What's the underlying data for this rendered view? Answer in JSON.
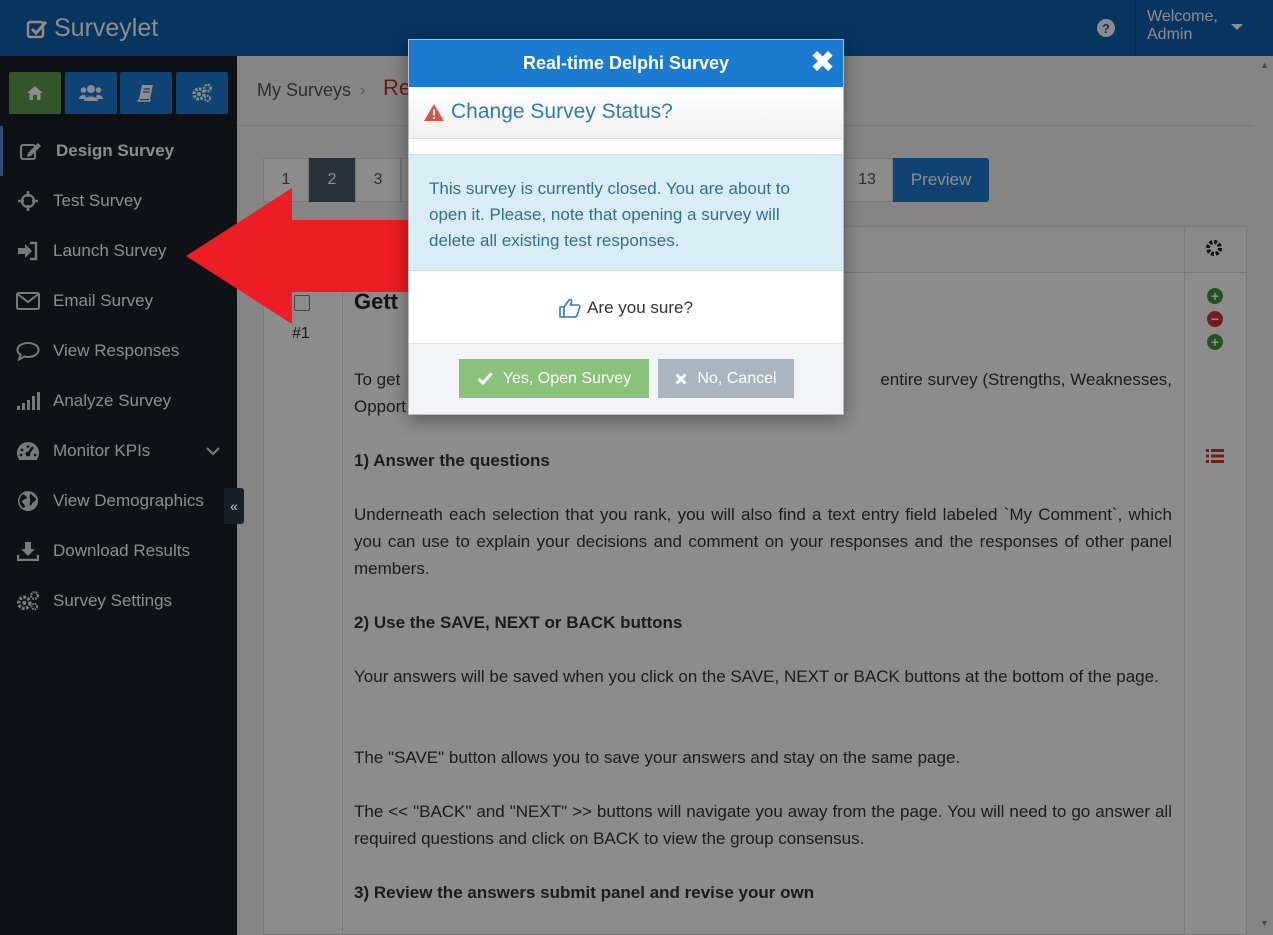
{
  "app": {
    "brand": "Surveylet"
  },
  "header": {
    "welcome_line1": "Welcome,",
    "welcome_line2": "Admin"
  },
  "quick_buttons": [
    {
      "icon": "home-icon",
      "color": "#5b9b4f"
    },
    {
      "icon": "users-icon",
      "color": "#1a7bd1"
    },
    {
      "icon": "book-icon",
      "color": "#1a7bd1"
    },
    {
      "icon": "cogs-icon",
      "color": "#1a7bd1"
    }
  ],
  "sidebar": {
    "items": [
      {
        "label": "Design Survey",
        "icon": "edit-icon",
        "active": true
      },
      {
        "label": "Test Survey",
        "icon": "crosshair-icon"
      },
      {
        "label": "Launch Survey",
        "icon": "sign-in-icon"
      },
      {
        "label": "Email Survey",
        "icon": "envelope-icon"
      },
      {
        "label": "View Responses",
        "icon": "comment-icon"
      },
      {
        "label": "Analyze Survey",
        "icon": "signal-icon"
      },
      {
        "label": "Monitor KPIs",
        "icon": "dashboard-icon"
      },
      {
        "label": "View Demographics",
        "icon": "globe-icon"
      },
      {
        "label": "Download Results",
        "icon": "download-icon"
      },
      {
        "label": "Survey Settings",
        "icon": "cogs-icon"
      }
    ],
    "collapse_label": "«"
  },
  "breadcrumb": {
    "root": "My Surveys",
    "separator": "›",
    "current": "Re"
  },
  "pager": {
    "pages": [
      "1",
      "2",
      "3",
      "13"
    ],
    "active_page": "2",
    "preview_label": "Preview"
  },
  "question": {
    "number": "#1",
    "title_visible": "Gett",
    "intro": "To get",
    "intro_right": "entire survey (Strengths, Weaknesses,",
    "intro_line2": "Opport",
    "paragraphs": [
      {
        "bold": true,
        "text": "1) Answer the questions"
      },
      {
        "bold": false,
        "text": "Underneath each selection that you rank, you will also find a text entry field labeled `My Comment`, which you can use to explain your decisions and comment on your responses and the responses of other panel members."
      },
      {
        "bold": true,
        "text": "2) Use the SAVE, NEXT or BACK buttons"
      },
      {
        "bold": false,
        "text": "Your answers will be saved when you click on the SAVE, NEXT or BACK buttons at the bottom of the page."
      },
      {
        "bold": false,
        "text": "The \"SAVE\" button allows you to save your answers and stay on the same page."
      },
      {
        "bold": false,
        "text": "The << \"BACK\" and \"NEXT\" >> buttons will navigate you away from the page. You will need to go answer all required questions and click on BACK to view the group consensus."
      },
      {
        "bold": true,
        "text": "3) Review the answers submit panel and revise your own"
      }
    ]
  },
  "modal": {
    "title": "Real-time Delphi Survey",
    "close": "✖",
    "subtitle": "Change Survey Status?",
    "message": "This survey is currently closed. You are about to open it. Please, note that opening a survey will delete all existing test responses.",
    "question": "Are you sure?",
    "yes_label": "Yes, Open Survey",
    "no_label": "No, Cancel"
  },
  "colors": {
    "primary": "#1a7bd1",
    "sidebar": "#1a2028",
    "yes": "#89c27a",
    "no": "#a9b4c1",
    "arrow": "#ee1c24"
  }
}
